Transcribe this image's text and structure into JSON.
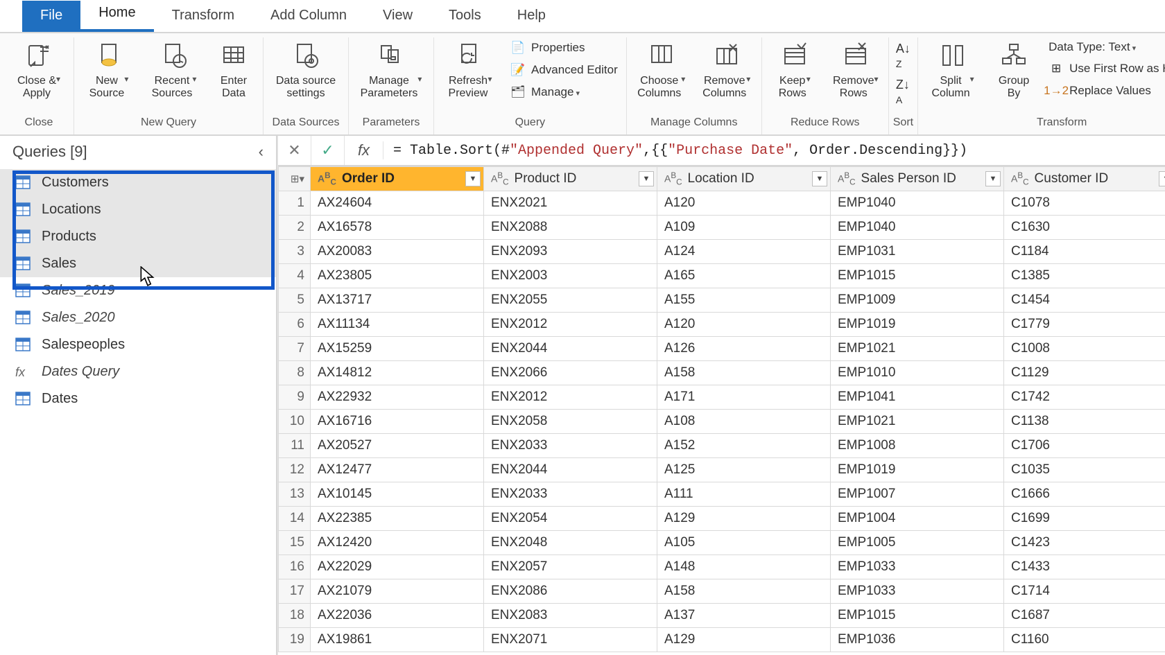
{
  "tabs": {
    "file": "File",
    "home": "Home",
    "transform": "Transform",
    "addcol": "Add Column",
    "view": "View",
    "tools": "Tools",
    "help": "Help"
  },
  "ribbon": {
    "close_group_label": "Close",
    "close_apply": "Close &\nApply",
    "newquery_group_label": "New Query",
    "new_source": "New\nSource",
    "recent_sources": "Recent\nSources",
    "enter_data": "Enter\nData",
    "datasources_group_label": "Data Sources",
    "data_source_settings": "Data source\nsettings",
    "parameters_group_label": "Parameters",
    "manage_parameters": "Manage\nParameters",
    "query_group_label": "Query",
    "refresh_preview": "Refresh\nPreview",
    "properties": "Properties",
    "advanced_editor": "Advanced Editor",
    "manage": "Manage",
    "managecols_group_label": "Manage Columns",
    "choose_columns": "Choose\nColumns",
    "remove_columns": "Remove\nColumns",
    "reducerows_group_label": "Reduce Rows",
    "keep_rows": "Keep\nRows",
    "remove_rows": "Remove\nRows",
    "sort_group_label": "Sort",
    "transform_group_label": "Transform",
    "split_column": "Split\nColumn",
    "group_by": "Group\nBy",
    "data_type": "Data Type: Text",
    "first_row_headers": "Use First Row as Heade",
    "replace_values": "Replace Values"
  },
  "queries": {
    "header": "Queries [9]",
    "items": [
      {
        "name": "Customers",
        "type": "table",
        "italic": false
      },
      {
        "name": "Locations",
        "type": "table",
        "italic": false
      },
      {
        "name": "Products",
        "type": "table",
        "italic": false
      },
      {
        "name": "Sales",
        "type": "table",
        "italic": false
      },
      {
        "name": "Sales_2019",
        "type": "table",
        "italic": true
      },
      {
        "name": "Sales_2020",
        "type": "table",
        "italic": true
      },
      {
        "name": "Salespeoples",
        "type": "table",
        "italic": false
      },
      {
        "name": "Dates Query",
        "type": "fx",
        "italic": true
      },
      {
        "name": "Dates",
        "type": "table",
        "italic": false
      }
    ]
  },
  "formula": {
    "prefix": "= Table.Sort(#",
    "str1": "\"Appended Query\"",
    "mid": ",{{",
    "str2": "\"Purchase Date\"",
    "suffix": ", Order.Descending}})"
  },
  "grid": {
    "columns": [
      {
        "name": "Order ID",
        "type": "ABC",
        "selected": true
      },
      {
        "name": "Product ID",
        "type": "ABC",
        "selected": false
      },
      {
        "name": "Location ID",
        "type": "ABC",
        "selected": false
      },
      {
        "name": "Sales Person ID",
        "type": "ABC",
        "selected": false
      },
      {
        "name": "Customer ID",
        "type": "ABC",
        "selected": false
      }
    ],
    "rows": [
      [
        "AX24604",
        "ENX2021",
        "A120",
        "EMP1040",
        "C1078"
      ],
      [
        "AX16578",
        "ENX2088",
        "A109",
        "EMP1040",
        "C1630"
      ],
      [
        "AX20083",
        "ENX2093",
        "A124",
        "EMP1031",
        "C1184"
      ],
      [
        "AX23805",
        "ENX2003",
        "A165",
        "EMP1015",
        "C1385"
      ],
      [
        "AX13717",
        "ENX2055",
        "A155",
        "EMP1009",
        "C1454"
      ],
      [
        "AX11134",
        "ENX2012",
        "A120",
        "EMP1019",
        "C1779"
      ],
      [
        "AX15259",
        "ENX2044",
        "A126",
        "EMP1021",
        "C1008"
      ],
      [
        "AX14812",
        "ENX2066",
        "A158",
        "EMP1010",
        "C1129"
      ],
      [
        "AX22932",
        "ENX2012",
        "A171",
        "EMP1041",
        "C1742"
      ],
      [
        "AX16716",
        "ENX2058",
        "A108",
        "EMP1021",
        "C1138"
      ],
      [
        "AX20527",
        "ENX2033",
        "A152",
        "EMP1008",
        "C1706"
      ],
      [
        "AX12477",
        "ENX2044",
        "A125",
        "EMP1019",
        "C1035"
      ],
      [
        "AX10145",
        "ENX2033",
        "A111",
        "EMP1007",
        "C1666"
      ],
      [
        "AX22385",
        "ENX2054",
        "A129",
        "EMP1004",
        "C1699"
      ],
      [
        "AX12420",
        "ENX2048",
        "A105",
        "EMP1005",
        "C1423"
      ],
      [
        "AX22029",
        "ENX2057",
        "A148",
        "EMP1033",
        "C1433"
      ],
      [
        "AX21079",
        "ENX2086",
        "A158",
        "EMP1033",
        "C1714"
      ],
      [
        "AX22036",
        "ENX2083",
        "A137",
        "EMP1015",
        "C1687"
      ],
      [
        "AX19861",
        "ENX2071",
        "A129",
        "EMP1036",
        "C1160"
      ]
    ]
  }
}
